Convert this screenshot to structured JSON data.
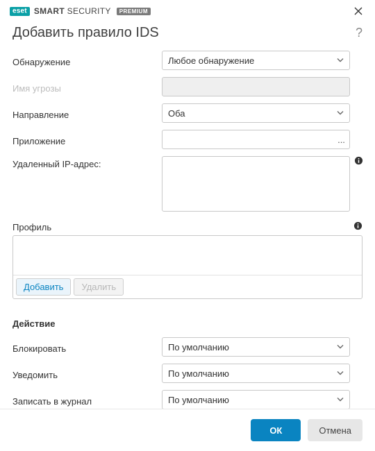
{
  "brand": {
    "logo_text": "eset",
    "product_strong": "SMART",
    "product_rest": " SECURITY",
    "badge": "PREMIUM"
  },
  "dialog": {
    "title": "Добавить правило IDS"
  },
  "labels": {
    "detection": "Обнаружение",
    "threat_name": "Имя угрозы",
    "direction": "Направление",
    "application": "Приложение",
    "remote_ip": "Удаленный IP-адрес:",
    "profile": "Профиль",
    "action_section": "Действие",
    "block": "Блокировать",
    "notify": "Уведомить",
    "log": "Записать в журнал"
  },
  "values": {
    "detection": "Любое обнаружение",
    "threat_name": "",
    "direction": "Оба",
    "application": "",
    "remote_ip": "",
    "block": "По умолчанию",
    "notify": "По умолчанию",
    "log": "По умолчанию"
  },
  "buttons": {
    "add": "Добавить",
    "remove": "Удалить",
    "ok": "ОК",
    "cancel": "Отмена"
  }
}
